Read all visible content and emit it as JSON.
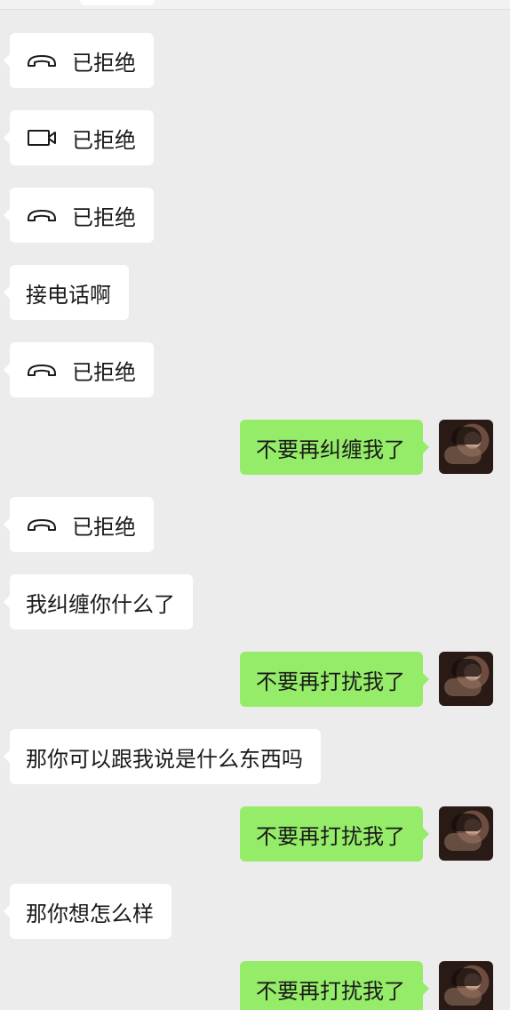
{
  "messages": [
    {
      "side": "in",
      "type": "voice-call",
      "icon": "phone-hangup-icon",
      "text": "已拒绝"
    },
    {
      "side": "in",
      "type": "video-call",
      "icon": "video-camera-icon",
      "text": "已拒绝"
    },
    {
      "side": "in",
      "type": "voice-call",
      "icon": "phone-hangup-icon",
      "text": "已拒绝"
    },
    {
      "side": "in",
      "type": "text",
      "text": "接电话啊"
    },
    {
      "side": "in",
      "type": "voice-call",
      "icon": "phone-hangup-icon",
      "text": "已拒绝"
    },
    {
      "side": "out",
      "type": "text",
      "text": "不要再纠缠我了"
    },
    {
      "side": "in",
      "type": "voice-call",
      "icon": "phone-hangup-icon",
      "text": "已拒绝"
    },
    {
      "side": "in",
      "type": "text",
      "text": "我纠缠你什么了"
    },
    {
      "side": "out",
      "type": "text",
      "text": "不要再打扰我了"
    },
    {
      "side": "in",
      "type": "text",
      "text": "那你可以跟我说是什么东西吗"
    },
    {
      "side": "out",
      "type": "text",
      "text": "不要再打扰我了"
    },
    {
      "side": "in",
      "type": "text",
      "text": "那你想怎么样"
    },
    {
      "side": "out",
      "type": "text",
      "text": "不要再打扰我了"
    }
  ],
  "colors": {
    "background": "#ececec",
    "incoming_bubble": "#ffffff",
    "outgoing_bubble": "#95ec69",
    "text": "#1a1a1a"
  }
}
